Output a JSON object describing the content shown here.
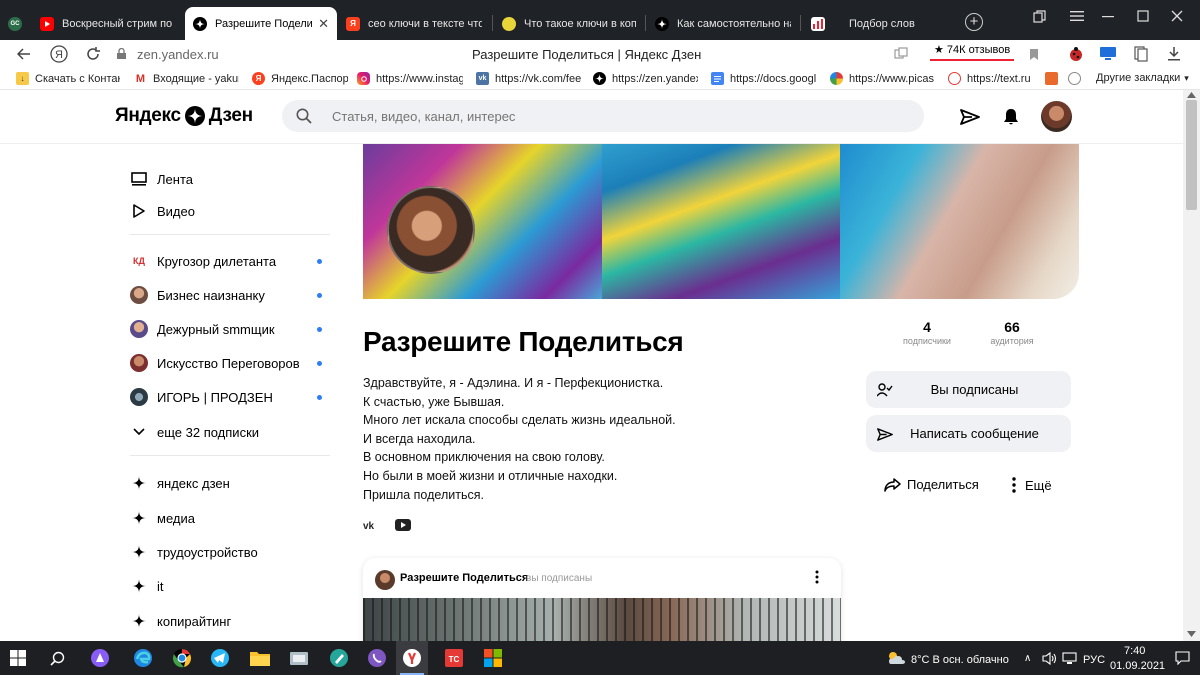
{
  "browser": {
    "tabs": [
      {
        "title": "Воскресный стрим по Янд",
        "icon": "youtube-icon",
        "active": false
      },
      {
        "title": "Разрешите Поделиться",
        "icon": "zen-icon",
        "active": true
      },
      {
        "title": "сео ключи в тексте что э",
        "icon": "yandex-icon",
        "active": false
      },
      {
        "title": "Что такое ключи в копир",
        "icon": "lemon-icon",
        "active": false
      },
      {
        "title": "Как самостоятельно напи",
        "icon": "zen-icon",
        "active": false
      },
      {
        "title": "Подбор слов",
        "icon": "wordstat-icon",
        "active": false
      }
    ],
    "url": "zen.yandex.ru",
    "page_title": "Разрешите Поделиться | Яндекс Дзен",
    "reviews_badge": "★ 74К отзывов",
    "bookmarks": [
      {
        "label": "Скачать с Контакт",
        "icon": "download-icon"
      },
      {
        "label": "Входящие - yakun",
        "icon": "gmail-icon"
      },
      {
        "label": "Яндекс.Паспорт",
        "icon": "yandex-icon"
      },
      {
        "label": "https://www.instag",
        "icon": "instagram-icon"
      },
      {
        "label": "https://vk.com/fee",
        "icon": "vk-icon"
      },
      {
        "label": "https://zen.yandex",
        "icon": "zen-icon"
      },
      {
        "label": "https://docs.googl",
        "icon": "docs-icon"
      },
      {
        "label": "https://www.picas",
        "icon": "picasa-icon"
      },
      {
        "label": "https://text.ru",
        "icon": "textru-icon"
      }
    ],
    "other_bookmarks": "Другие закладки"
  },
  "zen": {
    "logo_left": "Яндекс",
    "logo_right": "Дзен",
    "search_placeholder": "Статья, видео, канал, интерес",
    "sidebar": {
      "nav": [
        {
          "label": "Лента",
          "icon": "feed-icon"
        },
        {
          "label": "Видео",
          "icon": "play-icon"
        }
      ],
      "subscriptions": [
        {
          "label": "Кругозор дилетанта",
          "avatar": "kd-avatar"
        },
        {
          "label": "Бизнес наизнанку",
          "avatar": "business-avatar"
        },
        {
          "label": "Дежурный smmщик",
          "avatar": "smm-avatar"
        },
        {
          "label": "Искусство Переговоров",
          "avatar": "negotiation-avatar"
        },
        {
          "label": "ИГОРЬ | ПРОДЗЕН",
          "avatar": "igor-avatar"
        }
      ],
      "more_subscriptions": "еще 32 подписки",
      "interests": [
        "яндекс дзен",
        "медиа",
        "трудоустройство",
        "it",
        "копирайтинг"
      ]
    },
    "channel": {
      "title": "Разрешите Поделиться",
      "description": [
        "Здравствуйте, я - Адэлина. И я - Перфекционистка.",
        "К счастью, уже Бывшая.",
        "Много лет искала способы сделать жизнь идеальной.",
        "И всегда находила.",
        "В основном приключения на свою голову.",
        "Но были в моей жизни и отличные находки.",
        "Пришла поделиться."
      ],
      "subscribers_count": "4",
      "subscribers_label": "подписчики",
      "audience_count": "66",
      "audience_label": "аудитория",
      "subscribed_button": "Вы подписаны",
      "message_button": "Написать сообщение",
      "share_label": "Поделиться",
      "more_label": "Ещё"
    },
    "post": {
      "channel_name": "Разрешите Поделиться",
      "status": "вы подписаны"
    }
  },
  "taskbar": {
    "weather": "8°C  В осн. облачно",
    "language": "РУС",
    "time": "7:40",
    "date": "01.09.2021"
  },
  "colors": {
    "accent_blue": "#2e7cf6",
    "tabbar_bg": "#1f2226",
    "taskbar_bg": "#1e1f22",
    "button_bg": "#f0f1f4"
  }
}
